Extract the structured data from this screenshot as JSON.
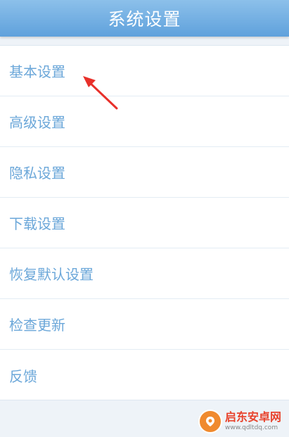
{
  "header": {
    "title": "系统设置"
  },
  "menu": {
    "items": [
      {
        "label": "基本设置"
      },
      {
        "label": "高级设置"
      },
      {
        "label": "隐私设置"
      },
      {
        "label": "下载设置"
      },
      {
        "label": "恢复默认设置"
      },
      {
        "label": "检查更新"
      },
      {
        "label": "反馈"
      }
    ]
  },
  "annotation": {
    "arrow_color": "#e8302a"
  },
  "watermark": {
    "name": "启东安卓网",
    "url": "www.qdltdq.com",
    "logo_color": "#f08a2e"
  }
}
